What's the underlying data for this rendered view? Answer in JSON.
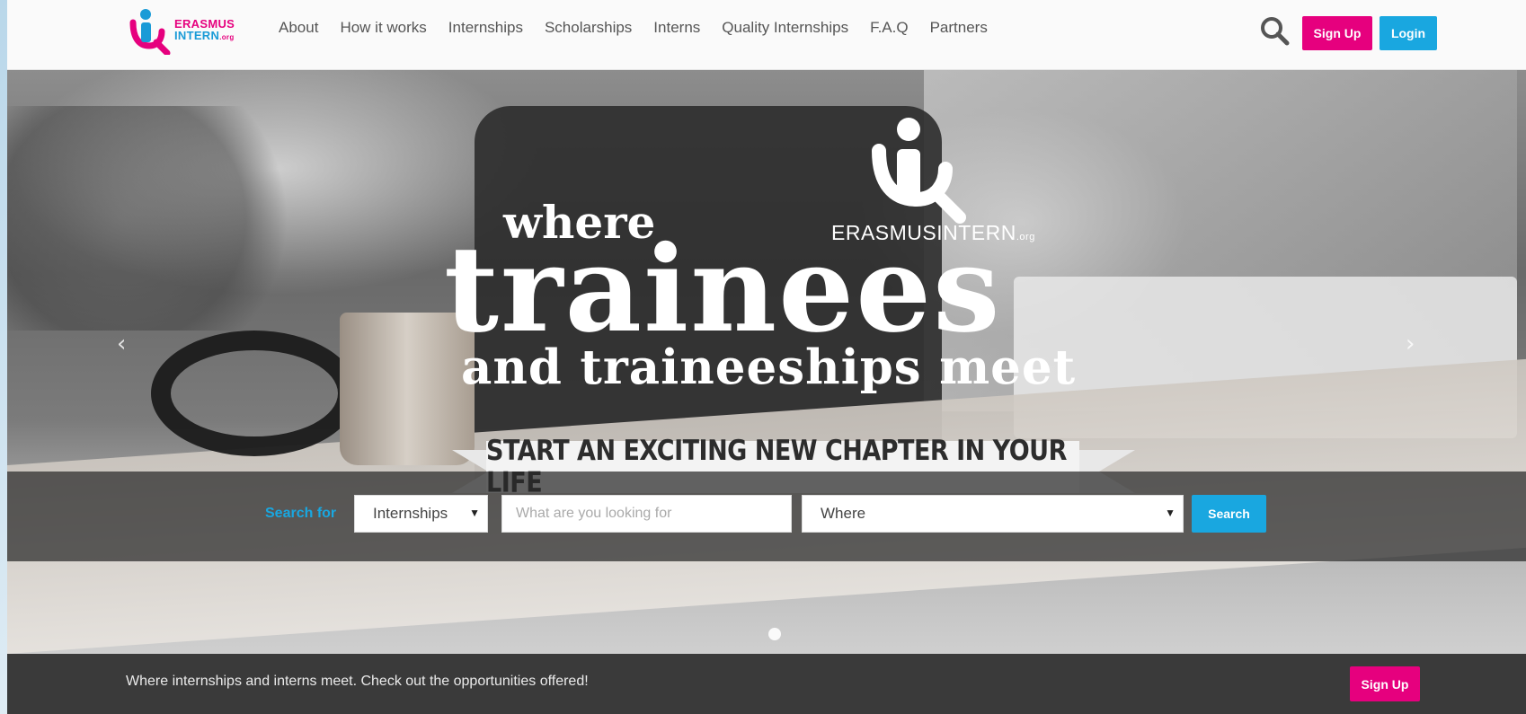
{
  "brand": {
    "line1": "ERASMUS",
    "line2": "INTERN",
    "suffix": ".org",
    "hero_name": "ERASMUSINTERN",
    "hero_suffix": ".org",
    "colors": {
      "pink": "#e6007e",
      "blue": "#19a7e0"
    }
  },
  "nav": {
    "items": [
      "About",
      "How it works",
      "Internships",
      "Scholarships",
      "Interns",
      "Quality Internships",
      "F.A.Q",
      "Partners"
    ]
  },
  "header": {
    "search_icon": "search-icon",
    "signup_label": "Sign Up",
    "login_label": "Login"
  },
  "hero": {
    "where": "where",
    "trainees": "trainees",
    "meet": "and traineeships meet",
    "banner": "START AN EXCITING NEW CHAPTER IN YOUR LIFE",
    "prev_arrow": "‹",
    "next_arrow": "›"
  },
  "search": {
    "label": "Search for",
    "type_value": "Internships",
    "query_placeholder": "What are you looking for",
    "where_value": "Where",
    "button_label": "Search",
    "caret": "▼"
  },
  "footer": {
    "text": "Where internships and interns meet. Check out the opportunities offered!",
    "signup_label": "Sign Up"
  }
}
